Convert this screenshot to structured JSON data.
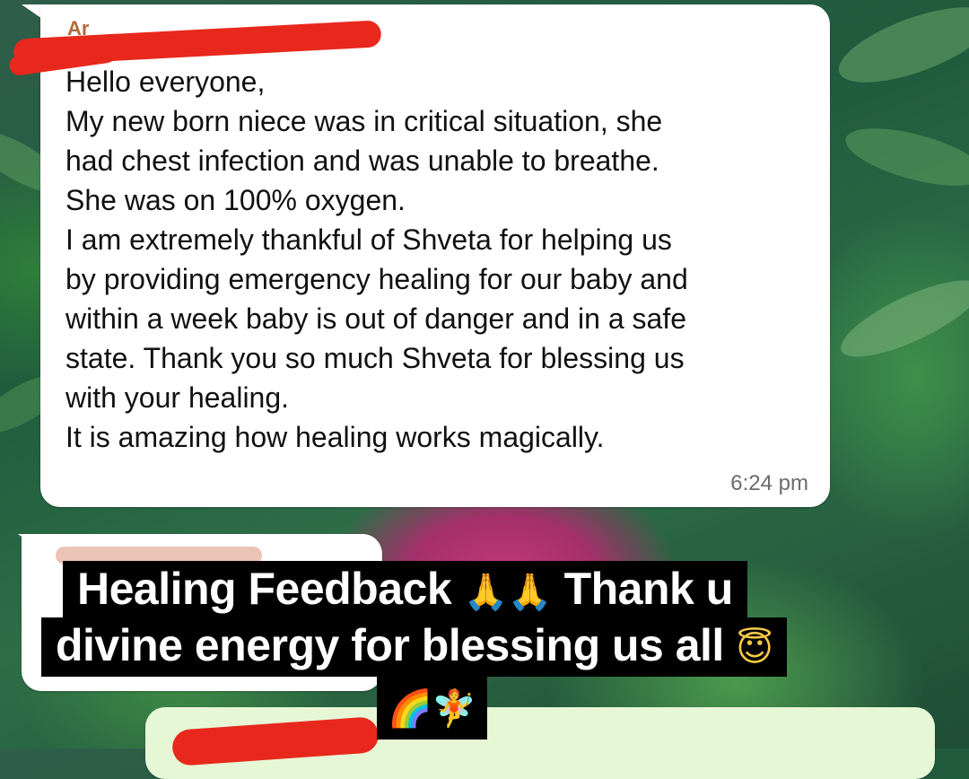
{
  "chat": {
    "message1": {
      "sender": "Ar",
      "lines": [
        "Hello everyone,",
        "My new born niece was in critical situation, she",
        "had chest infection and was unable to breathe.",
        "She was on 100% oxygen.",
        "I am extremely thankful of Shveta for helping us",
        "by providing emergency healing for our baby and",
        "within a week baby is out of danger and in a safe",
        "state. Thank you so much Shveta for blessing us",
        "with your healing.",
        "It is amazing how healing works magically."
      ],
      "time": "6:24 pm"
    }
  },
  "caption": {
    "line1_text1": "Healing Feedback",
    "line1_emoji": "🙏🙏",
    "line1_text2": "Thank u",
    "line2_text": "divine energy for blessing us all",
    "line2_emoji": "😇",
    "line3_emoji": "🌈🧚"
  },
  "colors": {
    "bubble": "#ffffff",
    "redaction": "#e8281d",
    "caption_bg": "#000000",
    "caption_text": "#ffffff"
  }
}
